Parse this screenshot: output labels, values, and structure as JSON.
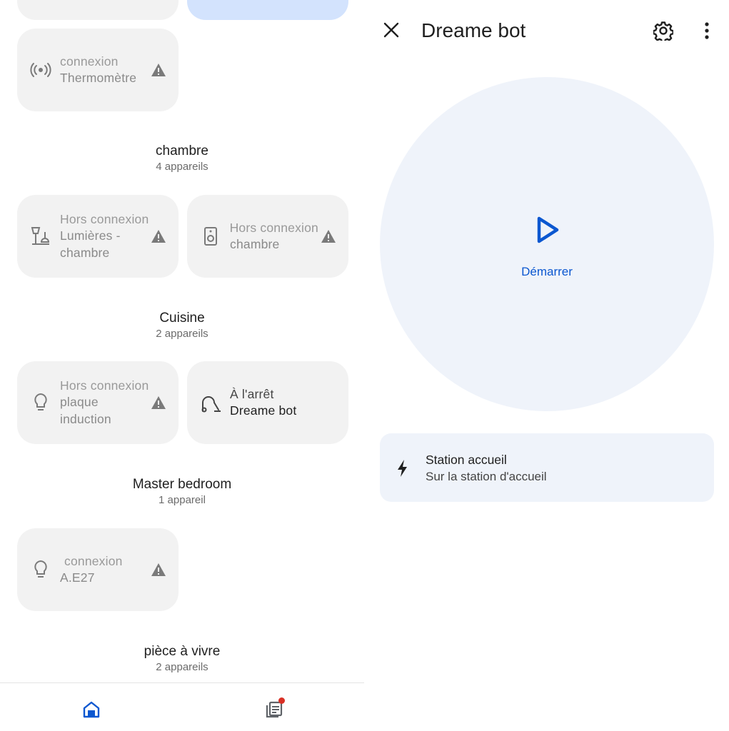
{
  "rooms": [
    {
      "name": "chambre",
      "count": "4 appareils"
    },
    {
      "name": "Cuisine",
      "count": "2 appareils"
    },
    {
      "name": "Master bedroom",
      "count": "1 appareil"
    },
    {
      "name": "pièce à vivre",
      "count": "2 appareils"
    }
  ],
  "tiles": {
    "thermometer": {
      "status": "connexion",
      "name": "Thermomètre"
    },
    "lights_chambre": {
      "status": "Hors connexion",
      "name": "Lumières - chambre"
    },
    "speaker_chambre": {
      "status": "Hors connexion",
      "name": "chambre"
    },
    "induction": {
      "status": "Hors connexion",
      "name": "plaque induction"
    },
    "dreame": {
      "status": "À l'arrêt",
      "name": "Dreame bot"
    },
    "bulb_e27": {
      "status": "connexion",
      "name": "A.E27"
    }
  },
  "detail": {
    "title": "Dreame bot",
    "start_label": "Démarrer",
    "station_title": "Station accueil",
    "station_subtitle": "Sur la station d'accueil"
  },
  "colors": {
    "accent": "#0b57d0",
    "tile_bg": "#f2f2f2",
    "panel_bg": "#eff3fa",
    "badge": "#d93025"
  }
}
